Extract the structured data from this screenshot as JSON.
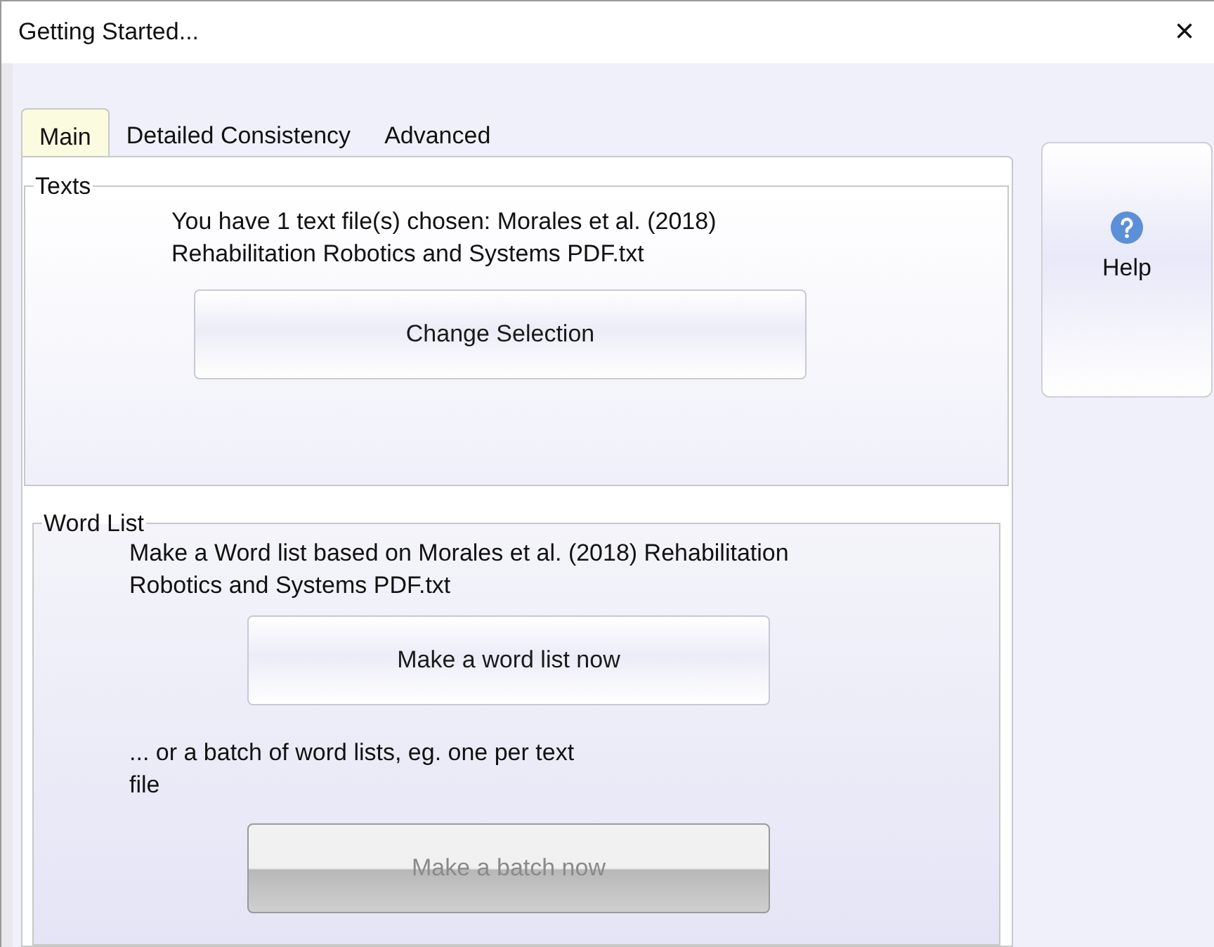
{
  "window": {
    "title": "Getting Started...",
    "close": "×"
  },
  "tabs": [
    {
      "label": "Main",
      "selected": true
    },
    {
      "label": "Detailed Consistency",
      "selected": false
    },
    {
      "label": "Advanced",
      "selected": false
    }
  ],
  "texts_group": {
    "title": "Texts",
    "message": "You have 1 text file(s) chosen: Morales et al. (2018) Rehabilitation Robotics and Systems PDF.txt",
    "button": {
      "label": "Change Selection",
      "disabled": false
    }
  },
  "word_list_group": {
    "title": "Word List",
    "message": "Make a Word list based on Morales et al. (2018) Rehabilitation Robotics and Systems PDF.txt",
    "button": {
      "label": "Make a word list now",
      "disabled": false
    },
    "batch_message": "... or a batch of word lists, eg. one per text file",
    "batch_button": {
      "label": "Make a batch now",
      "disabled": true
    }
  },
  "help_button": {
    "label": "Help"
  }
}
